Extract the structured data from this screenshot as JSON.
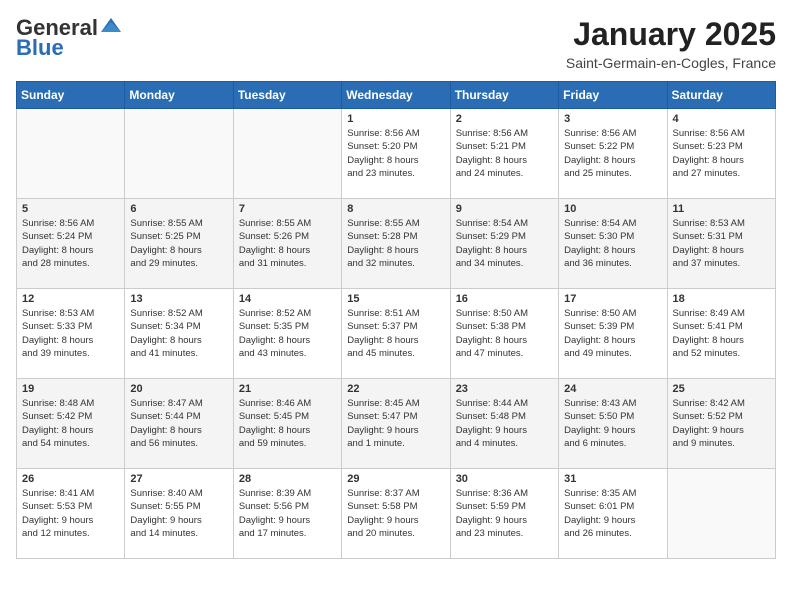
{
  "logo": {
    "general": "General",
    "blue": "Blue"
  },
  "title": "January 2025",
  "location": "Saint-Germain-en-Cogles, France",
  "days_header": [
    "Sunday",
    "Monday",
    "Tuesday",
    "Wednesday",
    "Thursday",
    "Friday",
    "Saturday"
  ],
  "weeks": [
    [
      {
        "day": "",
        "info": ""
      },
      {
        "day": "",
        "info": ""
      },
      {
        "day": "",
        "info": ""
      },
      {
        "day": "1",
        "info": "Sunrise: 8:56 AM\nSunset: 5:20 PM\nDaylight: 8 hours\nand 23 minutes."
      },
      {
        "day": "2",
        "info": "Sunrise: 8:56 AM\nSunset: 5:21 PM\nDaylight: 8 hours\nand 24 minutes."
      },
      {
        "day": "3",
        "info": "Sunrise: 8:56 AM\nSunset: 5:22 PM\nDaylight: 8 hours\nand 25 minutes."
      },
      {
        "day": "4",
        "info": "Sunrise: 8:56 AM\nSunset: 5:23 PM\nDaylight: 8 hours\nand 27 minutes."
      }
    ],
    [
      {
        "day": "5",
        "info": "Sunrise: 8:56 AM\nSunset: 5:24 PM\nDaylight: 8 hours\nand 28 minutes."
      },
      {
        "day": "6",
        "info": "Sunrise: 8:55 AM\nSunset: 5:25 PM\nDaylight: 8 hours\nand 29 minutes."
      },
      {
        "day": "7",
        "info": "Sunrise: 8:55 AM\nSunset: 5:26 PM\nDaylight: 8 hours\nand 31 minutes."
      },
      {
        "day": "8",
        "info": "Sunrise: 8:55 AM\nSunset: 5:28 PM\nDaylight: 8 hours\nand 32 minutes."
      },
      {
        "day": "9",
        "info": "Sunrise: 8:54 AM\nSunset: 5:29 PM\nDaylight: 8 hours\nand 34 minutes."
      },
      {
        "day": "10",
        "info": "Sunrise: 8:54 AM\nSunset: 5:30 PM\nDaylight: 8 hours\nand 36 minutes."
      },
      {
        "day": "11",
        "info": "Sunrise: 8:53 AM\nSunset: 5:31 PM\nDaylight: 8 hours\nand 37 minutes."
      }
    ],
    [
      {
        "day": "12",
        "info": "Sunrise: 8:53 AM\nSunset: 5:33 PM\nDaylight: 8 hours\nand 39 minutes."
      },
      {
        "day": "13",
        "info": "Sunrise: 8:52 AM\nSunset: 5:34 PM\nDaylight: 8 hours\nand 41 minutes."
      },
      {
        "day": "14",
        "info": "Sunrise: 8:52 AM\nSunset: 5:35 PM\nDaylight: 8 hours\nand 43 minutes."
      },
      {
        "day": "15",
        "info": "Sunrise: 8:51 AM\nSunset: 5:37 PM\nDaylight: 8 hours\nand 45 minutes."
      },
      {
        "day": "16",
        "info": "Sunrise: 8:50 AM\nSunset: 5:38 PM\nDaylight: 8 hours\nand 47 minutes."
      },
      {
        "day": "17",
        "info": "Sunrise: 8:50 AM\nSunset: 5:39 PM\nDaylight: 8 hours\nand 49 minutes."
      },
      {
        "day": "18",
        "info": "Sunrise: 8:49 AM\nSunset: 5:41 PM\nDaylight: 8 hours\nand 52 minutes."
      }
    ],
    [
      {
        "day": "19",
        "info": "Sunrise: 8:48 AM\nSunset: 5:42 PM\nDaylight: 8 hours\nand 54 minutes."
      },
      {
        "day": "20",
        "info": "Sunrise: 8:47 AM\nSunset: 5:44 PM\nDaylight: 8 hours\nand 56 minutes."
      },
      {
        "day": "21",
        "info": "Sunrise: 8:46 AM\nSunset: 5:45 PM\nDaylight: 8 hours\nand 59 minutes."
      },
      {
        "day": "22",
        "info": "Sunrise: 8:45 AM\nSunset: 5:47 PM\nDaylight: 9 hours\nand 1 minute."
      },
      {
        "day": "23",
        "info": "Sunrise: 8:44 AM\nSunset: 5:48 PM\nDaylight: 9 hours\nand 4 minutes."
      },
      {
        "day": "24",
        "info": "Sunrise: 8:43 AM\nSunset: 5:50 PM\nDaylight: 9 hours\nand 6 minutes."
      },
      {
        "day": "25",
        "info": "Sunrise: 8:42 AM\nSunset: 5:52 PM\nDaylight: 9 hours\nand 9 minutes."
      }
    ],
    [
      {
        "day": "26",
        "info": "Sunrise: 8:41 AM\nSunset: 5:53 PM\nDaylight: 9 hours\nand 12 minutes."
      },
      {
        "day": "27",
        "info": "Sunrise: 8:40 AM\nSunset: 5:55 PM\nDaylight: 9 hours\nand 14 minutes."
      },
      {
        "day": "28",
        "info": "Sunrise: 8:39 AM\nSunset: 5:56 PM\nDaylight: 9 hours\nand 17 minutes."
      },
      {
        "day": "29",
        "info": "Sunrise: 8:37 AM\nSunset: 5:58 PM\nDaylight: 9 hours\nand 20 minutes."
      },
      {
        "day": "30",
        "info": "Sunrise: 8:36 AM\nSunset: 5:59 PM\nDaylight: 9 hours\nand 23 minutes."
      },
      {
        "day": "31",
        "info": "Sunrise: 8:35 AM\nSunset: 6:01 PM\nDaylight: 9 hours\nand 26 minutes."
      },
      {
        "day": "",
        "info": ""
      }
    ]
  ]
}
